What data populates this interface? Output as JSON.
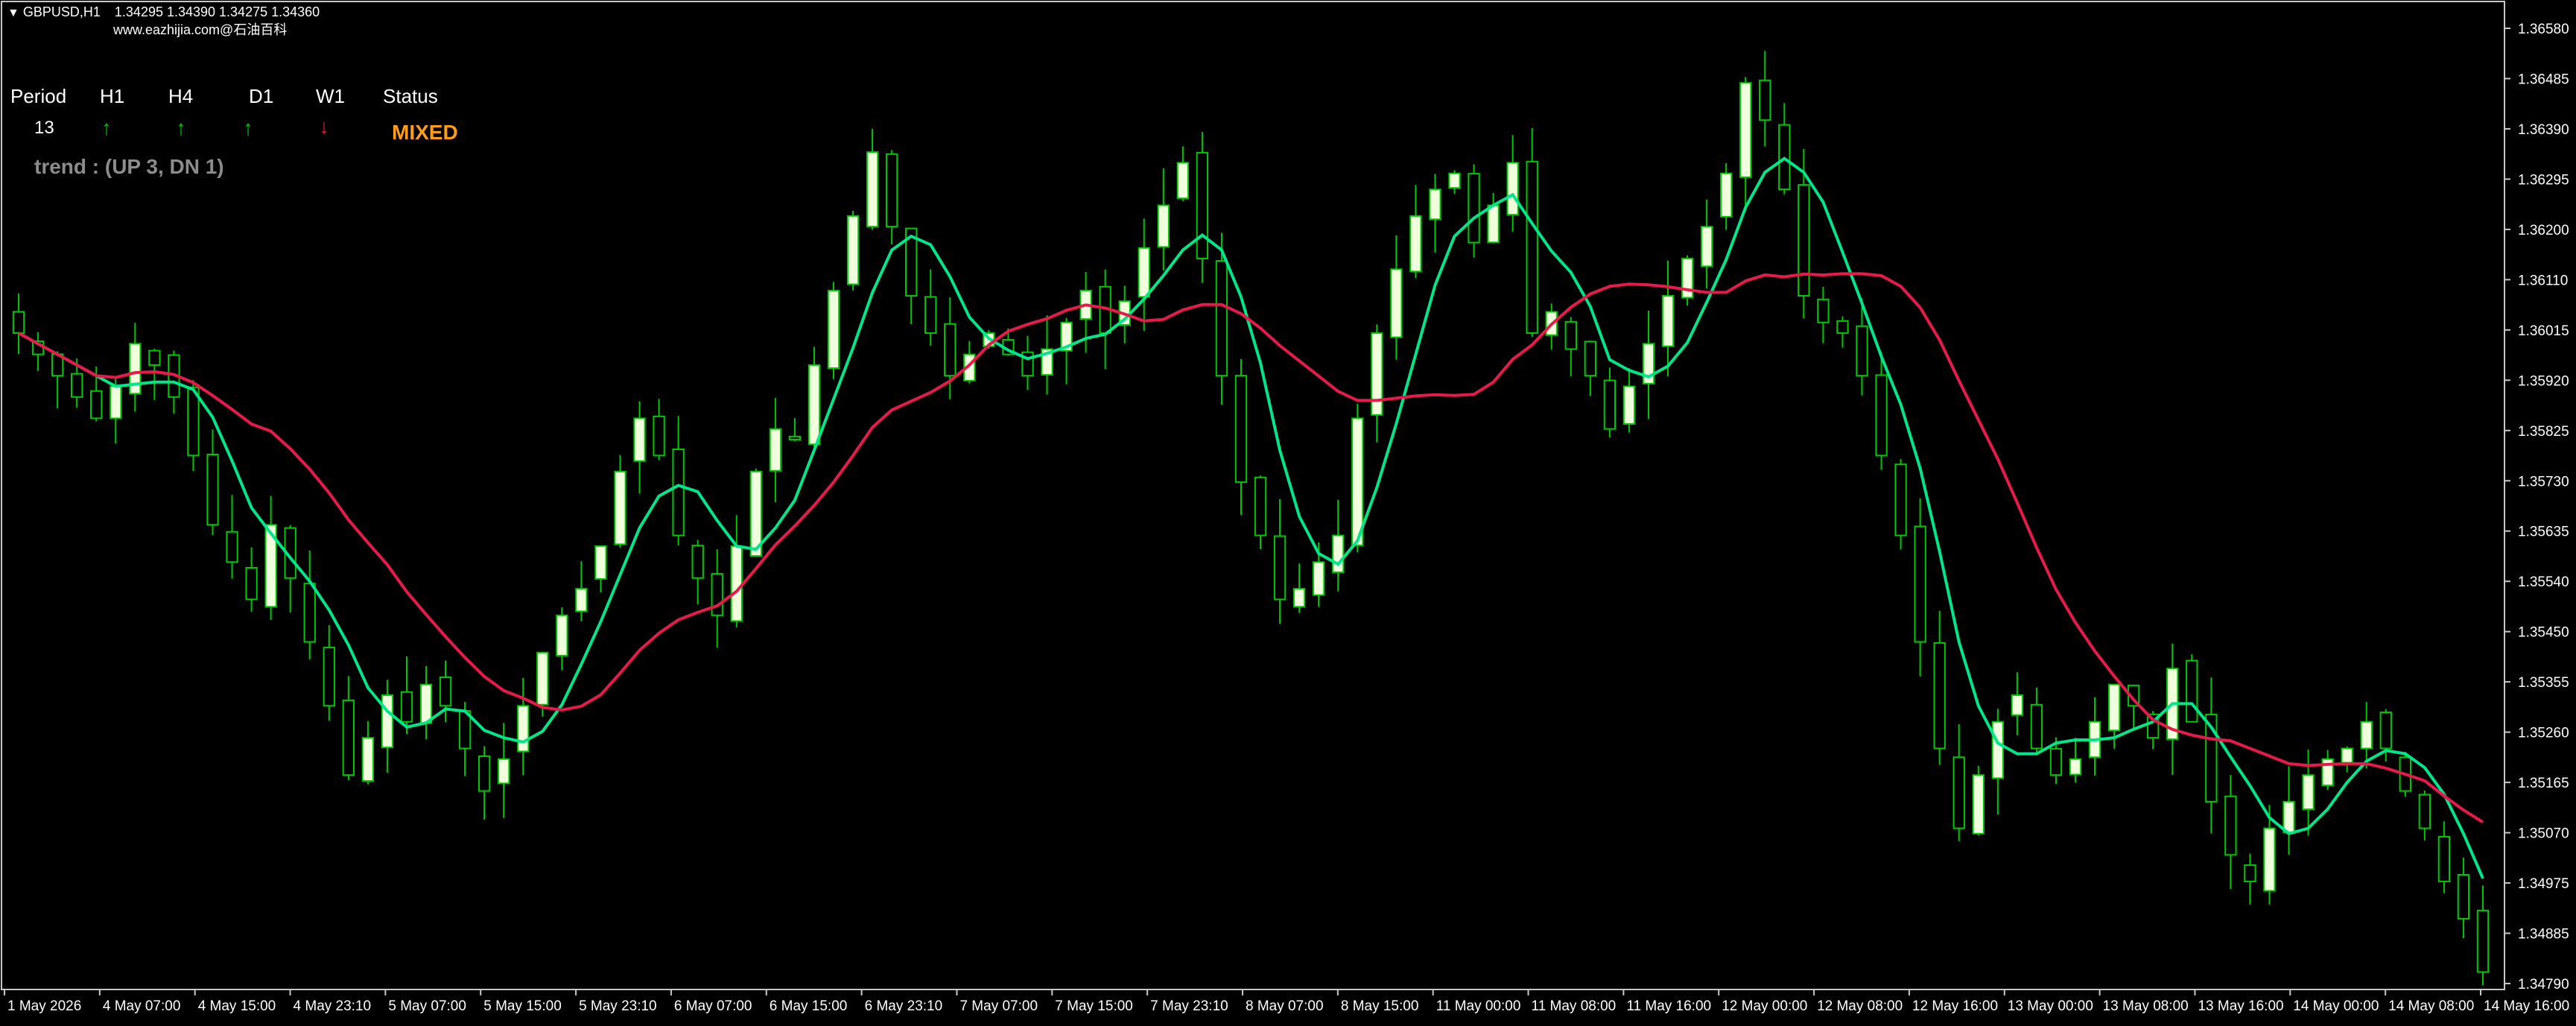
{
  "header": {
    "symbol": "GBPUSD,H1",
    "ohlc": "1.34295 1.34390 1.34275 1.34360",
    "watermark": "www.eazhijia.com@石油百科"
  },
  "indicator_panel": {
    "headers": [
      "Period",
      "H1",
      "H4",
      "D1",
      "W1",
      "Status"
    ],
    "period_value": "13",
    "arrows": [
      {
        "tf": "H1",
        "direction": "up",
        "glyph": "↑",
        "color": "#00c800"
      },
      {
        "tf": "H4",
        "direction": "up",
        "glyph": "↑",
        "color": "#00c800"
      },
      {
        "tf": "D1",
        "direction": "up",
        "glyph": "↑",
        "color": "#00c800"
      },
      {
        "tf": "W1",
        "direction": "down",
        "glyph": "↓",
        "color": "#e02020"
      }
    ],
    "status": "MIXED",
    "status_color": "#ff9c1a",
    "trend_text": "trend : (UP 3, DN 1)",
    "trend_color": "#8c8c8c"
  },
  "colors": {
    "background": "#000000",
    "candle_up_fill": "#f0ffdc",
    "candle_outline": "#00c800",
    "ma_fast": "#00e68a",
    "ma_medium_up": "#19e38b",
    "ma_down": "#e8194b",
    "axis": "#c8c8c8"
  },
  "chart_data": {
    "type": "candlestick",
    "symbol": "GBPUSD",
    "timeframe": "H1",
    "ylim": [
      1.3475,
      1.366
    ],
    "y_ticks": [
      "1.36580",
      "1.36485",
      "1.36390",
      "1.36295",
      "1.36200",
      "1.36110",
      "1.36015",
      "1.35920",
      "1.35825",
      "1.35730",
      "1.35635",
      "1.35540",
      "1.35450",
      "1.35355",
      "1.35260",
      "1.35165",
      "1.35070",
      "1.34975",
      "1.34885",
      "1.34790"
    ],
    "x_ticks": [
      "1 May 2026",
      "4 May 07:00",
      "4 May 15:00",
      "4 May 23:10",
      "5 May 07:00",
      "5 May 15:00",
      "5 May 23:10",
      "6 May 07:00",
      "6 May 15:00",
      "6 May 23:10",
      "7 May 07:00",
      "7 May 15:00",
      "7 May 23:10",
      "8 May 07:00",
      "8 May 15:00",
      "11 May 00:00",
      "11 May 08:00",
      "11 May 16:00",
      "12 May 00:00",
      "12 May 08:00",
      "12 May 16:00",
      "13 May 00:00",
      "13 May 08:00",
      "13 May 16:00",
      "14 May 00:00",
      "14 May 08:00",
      "14 May 16:00"
    ],
    "close_path": [
      1.3598,
      1.3594,
      1.359,
      1.3586,
      1.3582,
      1.3588,
      1.3596,
      1.3592,
      1.3586,
      1.3575,
      1.3562,
      1.3555,
      1.3548,
      1.3562,
      1.3552,
      1.354,
      1.3528,
      1.3515,
      1.3522,
      1.353,
      1.3525,
      1.3532,
      1.3528,
      1.352,
      1.3512,
      1.3518,
      1.3528,
      1.3538,
      1.3545,
      1.355,
      1.3558,
      1.3572,
      1.3582,
      1.3575,
      1.356,
      1.3552,
      1.3545,
      1.3558,
      1.3572,
      1.358,
      1.3578,
      1.3592,
      1.3606,
      1.362,
      1.3632,
      1.3618,
      1.3605,
      1.3598,
      1.359,
      1.3594,
      1.3598,
      1.3594,
      1.359,
      1.3595,
      1.36,
      1.3606,
      1.3598,
      1.3604,
      1.3614,
      1.3622,
      1.363,
      1.3612,
      1.359,
      1.357,
      1.356,
      1.3548,
      1.355,
      1.3555,
      1.356,
      1.3582,
      1.3598,
      1.361,
      1.362,
      1.3625,
      1.3628,
      1.3615,
      1.3622,
      1.363,
      1.3598,
      1.3602,
      1.3595,
      1.359,
      1.358,
      1.3588,
      1.3596,
      1.3605,
      1.3612,
      1.3618,
      1.3628,
      1.3645,
      1.3638,
      1.3625,
      1.3605,
      1.36,
      1.3598,
      1.359,
      1.3575,
      1.356,
      1.354,
      1.352,
      1.3505,
      1.3515,
      1.3525,
      1.353,
      1.352,
      1.3515,
      1.3518,
      1.3525,
      1.3532,
      1.3528,
      1.3522,
      1.3535,
      1.3525,
      1.351,
      1.35,
      1.3495,
      1.3505,
      1.351,
      1.3515,
      1.3518,
      1.352,
      1.3525,
      1.352,
      1.3512,
      1.3505,
      1.3495,
      1.3488,
      1.3478
    ]
  }
}
